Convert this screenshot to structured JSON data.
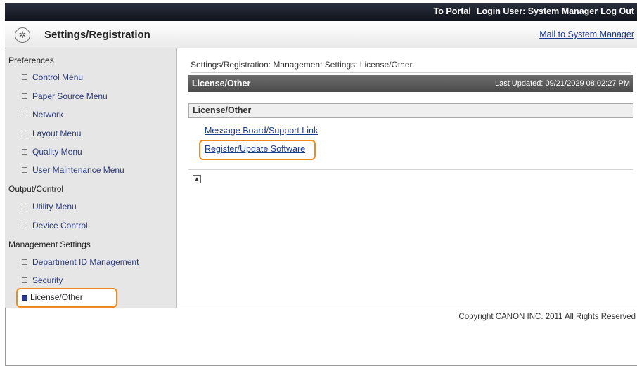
{
  "topbar": {
    "portal_link": "To Portal",
    "login_user": "Login User: System Manager",
    "logout_link": "Log Out"
  },
  "header": {
    "title": "Settings/Registration",
    "mail_link": "Mail to System Manager"
  },
  "sidebar": {
    "sections": [
      {
        "label": "Preferences",
        "items": [
          "Control Menu",
          "Paper Source Menu",
          "Network",
          "Layout Menu",
          "Quality Menu",
          "User Maintenance Menu"
        ]
      },
      {
        "label": "Output/Control",
        "items": [
          "Utility Menu",
          "Device Control"
        ]
      },
      {
        "label": "Management Settings",
        "items": [
          "Department ID Management",
          "Security",
          "License/Other"
        ]
      }
    ],
    "selected": "License/Other"
  },
  "main": {
    "breadcrumb": "Settings/Registration: Management Settings: License/Other",
    "page_title": "License/Other",
    "last_updated": "Last Updated: 09/21/2029 08:02:27 PM",
    "section_title": "License/Other",
    "links": [
      "Message Board/Support Link",
      "Register/Update Software"
    ]
  },
  "footer": {
    "copyright": "Copyright CANON INC. 2011 All Rights Reserved"
  }
}
